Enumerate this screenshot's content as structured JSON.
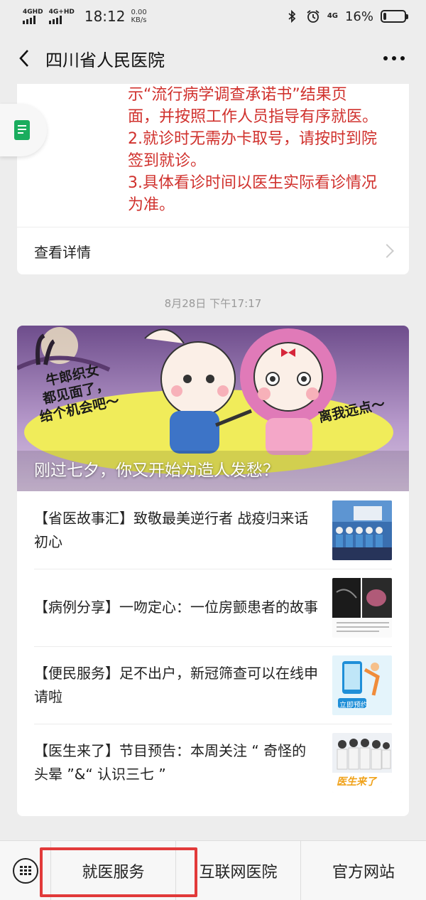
{
  "status_bar": {
    "signal1_label": "4GHD",
    "signal2_label": "4G+HD",
    "time": "18:12",
    "speed_value": "0.00",
    "speed_unit": "KB/s",
    "net_label": "4G",
    "battery_percent": "16%",
    "battery_level": 0.16
  },
  "nav": {
    "title": "四川省人民医院"
  },
  "notice_card": {
    "lines": [
      "示“流行病学调查承诺书”结果页",
      "面，并按照工作人员指导有序就医。",
      "2.就诊时无需办卡取号，请按时到院",
      "签到就诊。",
      "3.具体看诊时间以医生实际看诊情况",
      "为准。"
    ],
    "detail_label": "查看详情"
  },
  "timestamp": "8月28日 下午17:17",
  "banner": {
    "caption": "刚过七夕，你又开始为造人发愁？",
    "bubble_left": "牛郎织女\n都见面了，\n给个机会吧～",
    "bubble_right": "离我远点～"
  },
  "articles": [
    {
      "title": "【省医故事汇】致敬最美逆行者 战疫归来话初心",
      "thumb_icon": "group-photo-thumb"
    },
    {
      "title": "【病例分享】一吻定心：一位房颤患者的故事",
      "thumb_icon": "medical-scan-thumb"
    },
    {
      "title": "【便民服务】足不出户，新冠筛查可以在线申请啦",
      "thumb_icon": "phone-booking-thumb",
      "thumb_text": "立即预约"
    },
    {
      "title": "【医生来了】节目预告：本周关注 “ 奇怪的头晕 ”&“ 认识三七 ”",
      "thumb_icon": "doctors-thumb",
      "thumb_text": "医生来了"
    }
  ],
  "bottom_menu": {
    "items": [
      "就医服务",
      "互联网医院",
      "官方网站"
    ]
  },
  "colors": {
    "notice_red": "#d0312d",
    "highlight_red": "#e23a3a",
    "background": "#ededed"
  }
}
